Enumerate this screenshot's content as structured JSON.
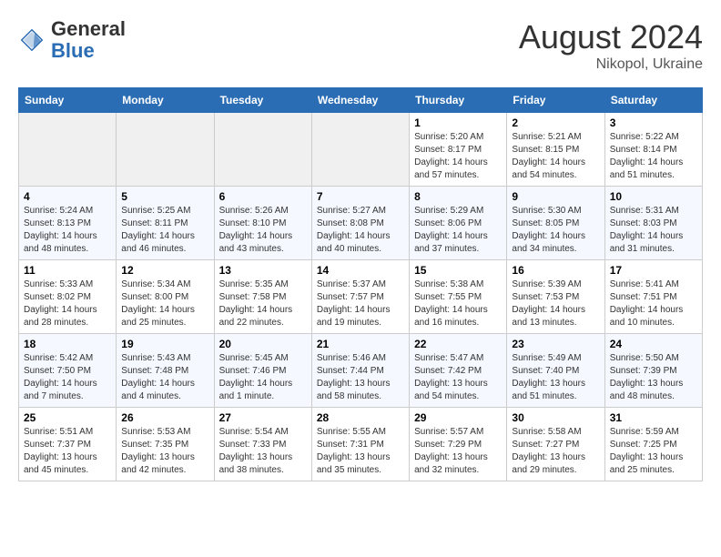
{
  "header": {
    "logo_general": "General",
    "logo_blue": "Blue",
    "title": "August 2024",
    "subtitle": "Nikopol, Ukraine"
  },
  "weekdays": [
    "Sunday",
    "Monday",
    "Tuesday",
    "Wednesday",
    "Thursday",
    "Friday",
    "Saturday"
  ],
  "weeks": [
    [
      {
        "day": "",
        "info": ""
      },
      {
        "day": "",
        "info": ""
      },
      {
        "day": "",
        "info": ""
      },
      {
        "day": "",
        "info": ""
      },
      {
        "day": "1",
        "info": "Sunrise: 5:20 AM\nSunset: 8:17 PM\nDaylight: 14 hours\nand 57 minutes."
      },
      {
        "day": "2",
        "info": "Sunrise: 5:21 AM\nSunset: 8:15 PM\nDaylight: 14 hours\nand 54 minutes."
      },
      {
        "day": "3",
        "info": "Sunrise: 5:22 AM\nSunset: 8:14 PM\nDaylight: 14 hours\nand 51 minutes."
      }
    ],
    [
      {
        "day": "4",
        "info": "Sunrise: 5:24 AM\nSunset: 8:13 PM\nDaylight: 14 hours\nand 48 minutes."
      },
      {
        "day": "5",
        "info": "Sunrise: 5:25 AM\nSunset: 8:11 PM\nDaylight: 14 hours\nand 46 minutes."
      },
      {
        "day": "6",
        "info": "Sunrise: 5:26 AM\nSunset: 8:10 PM\nDaylight: 14 hours\nand 43 minutes."
      },
      {
        "day": "7",
        "info": "Sunrise: 5:27 AM\nSunset: 8:08 PM\nDaylight: 14 hours\nand 40 minutes."
      },
      {
        "day": "8",
        "info": "Sunrise: 5:29 AM\nSunset: 8:06 PM\nDaylight: 14 hours\nand 37 minutes."
      },
      {
        "day": "9",
        "info": "Sunrise: 5:30 AM\nSunset: 8:05 PM\nDaylight: 14 hours\nand 34 minutes."
      },
      {
        "day": "10",
        "info": "Sunrise: 5:31 AM\nSunset: 8:03 PM\nDaylight: 14 hours\nand 31 minutes."
      }
    ],
    [
      {
        "day": "11",
        "info": "Sunrise: 5:33 AM\nSunset: 8:02 PM\nDaylight: 14 hours\nand 28 minutes."
      },
      {
        "day": "12",
        "info": "Sunrise: 5:34 AM\nSunset: 8:00 PM\nDaylight: 14 hours\nand 25 minutes."
      },
      {
        "day": "13",
        "info": "Sunrise: 5:35 AM\nSunset: 7:58 PM\nDaylight: 14 hours\nand 22 minutes."
      },
      {
        "day": "14",
        "info": "Sunrise: 5:37 AM\nSunset: 7:57 PM\nDaylight: 14 hours\nand 19 minutes."
      },
      {
        "day": "15",
        "info": "Sunrise: 5:38 AM\nSunset: 7:55 PM\nDaylight: 14 hours\nand 16 minutes."
      },
      {
        "day": "16",
        "info": "Sunrise: 5:39 AM\nSunset: 7:53 PM\nDaylight: 14 hours\nand 13 minutes."
      },
      {
        "day": "17",
        "info": "Sunrise: 5:41 AM\nSunset: 7:51 PM\nDaylight: 14 hours\nand 10 minutes."
      }
    ],
    [
      {
        "day": "18",
        "info": "Sunrise: 5:42 AM\nSunset: 7:50 PM\nDaylight: 14 hours\nand 7 minutes."
      },
      {
        "day": "19",
        "info": "Sunrise: 5:43 AM\nSunset: 7:48 PM\nDaylight: 14 hours\nand 4 minutes."
      },
      {
        "day": "20",
        "info": "Sunrise: 5:45 AM\nSunset: 7:46 PM\nDaylight: 14 hours\nand 1 minute."
      },
      {
        "day": "21",
        "info": "Sunrise: 5:46 AM\nSunset: 7:44 PM\nDaylight: 13 hours\nand 58 minutes."
      },
      {
        "day": "22",
        "info": "Sunrise: 5:47 AM\nSunset: 7:42 PM\nDaylight: 13 hours\nand 54 minutes."
      },
      {
        "day": "23",
        "info": "Sunrise: 5:49 AM\nSunset: 7:40 PM\nDaylight: 13 hours\nand 51 minutes."
      },
      {
        "day": "24",
        "info": "Sunrise: 5:50 AM\nSunset: 7:39 PM\nDaylight: 13 hours\nand 48 minutes."
      }
    ],
    [
      {
        "day": "25",
        "info": "Sunrise: 5:51 AM\nSunset: 7:37 PM\nDaylight: 13 hours\nand 45 minutes."
      },
      {
        "day": "26",
        "info": "Sunrise: 5:53 AM\nSunset: 7:35 PM\nDaylight: 13 hours\nand 42 minutes."
      },
      {
        "day": "27",
        "info": "Sunrise: 5:54 AM\nSunset: 7:33 PM\nDaylight: 13 hours\nand 38 minutes."
      },
      {
        "day": "28",
        "info": "Sunrise: 5:55 AM\nSunset: 7:31 PM\nDaylight: 13 hours\nand 35 minutes."
      },
      {
        "day": "29",
        "info": "Sunrise: 5:57 AM\nSunset: 7:29 PM\nDaylight: 13 hours\nand 32 minutes."
      },
      {
        "day": "30",
        "info": "Sunrise: 5:58 AM\nSunset: 7:27 PM\nDaylight: 13 hours\nand 29 minutes."
      },
      {
        "day": "31",
        "info": "Sunrise: 5:59 AM\nSunset: 7:25 PM\nDaylight: 13 hours\nand 25 minutes."
      }
    ]
  ]
}
